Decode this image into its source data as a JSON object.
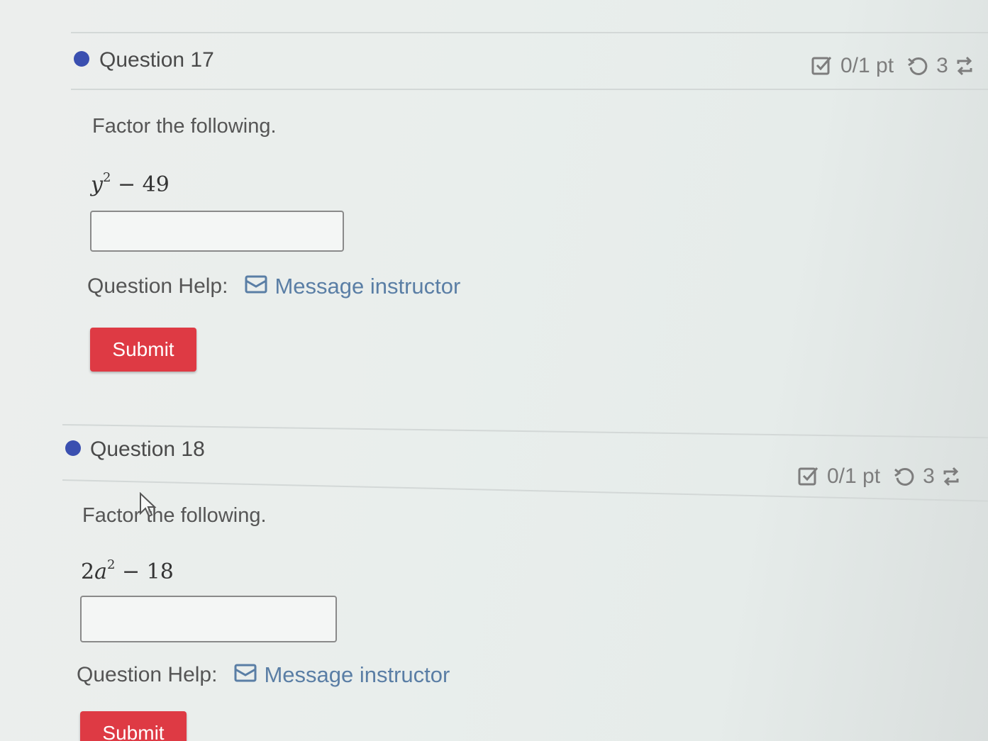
{
  "questions": [
    {
      "title": "Question 17",
      "score": "0/1 pt",
      "attempts": "3",
      "prompt": "Factor the following.",
      "expression": {
        "variable": "y",
        "exponent": "2",
        "rest": "− 49",
        "coef": ""
      },
      "answer_value": "",
      "help_label": "Question Help:",
      "message_label": "Message instructor",
      "submit_label": "Submit"
    },
    {
      "title": "Question 18",
      "score": "0/1 pt",
      "attempts": "3",
      "prompt": "Factor the following.",
      "expression": {
        "coef": "2",
        "variable": "a",
        "exponent": "2",
        "rest": "− 18"
      },
      "answer_value": "",
      "help_label": "Question Help:",
      "message_label": "Message instructor",
      "submit_label": "Submit"
    }
  ],
  "icons": {
    "score": "checkbox-edit-icon",
    "retry": "retry-icon",
    "refresh": "refresh-icon",
    "message": "envelope-icon"
  },
  "colors": {
    "bullet": "#3a4fb0",
    "submit": "#de3a44",
    "link": "#5a7ea5"
  }
}
